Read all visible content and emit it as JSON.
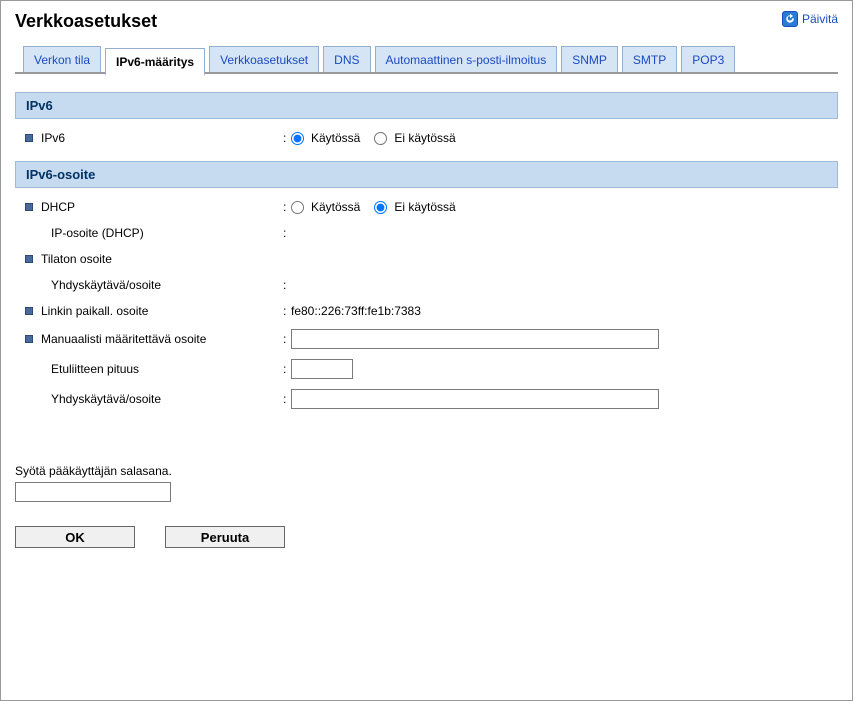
{
  "header": {
    "title": "Verkkoasetukset",
    "refresh_label": "Päivitä"
  },
  "tabs": {
    "verkon_tila": "Verkon tila",
    "ipv6_maaritys": "IPv6-määritys",
    "verkkoasetukset": "Verkkoasetukset",
    "dns": "DNS",
    "auto_mail": "Automaattinen s-posti-ilmoitus",
    "snmp": "SNMP",
    "smtp": "SMTP",
    "pop3": "POP3"
  },
  "sections": {
    "ipv6": {
      "header": "IPv6",
      "row_ipv6_label": "IPv6",
      "radio_enabled": "Käytössä",
      "radio_disabled": "Ei käytössä",
      "ipv6_selected": "enabled"
    },
    "ipv6_address": {
      "header": "IPv6-osoite",
      "dhcp_label": "DHCP",
      "dhcp_selected": "disabled",
      "ip_dhcp_label": "IP-osoite (DHCP)",
      "ip_dhcp_value": "",
      "stateless_label": "Tilaton osoite",
      "gateway_addr_label": "Yhdyskäytävä/osoite",
      "gateway_addr_value": "",
      "link_local_label": "Linkin paikall. osoite",
      "link_local_value": "fe80::226:73ff:fe1b:7383",
      "manual_label": "Manuaalisti määritettävä osoite",
      "manual_value": "",
      "prefix_label": "Etuliitteen pituus",
      "prefix_value": "",
      "gateway2_label": "Yhdyskäytävä/osoite",
      "gateway2_value": ""
    }
  },
  "footer": {
    "password_prompt": "Syötä pääkäyttäjän salasana.",
    "password_value": "",
    "ok_label": "OK",
    "cancel_label": "Peruuta"
  }
}
